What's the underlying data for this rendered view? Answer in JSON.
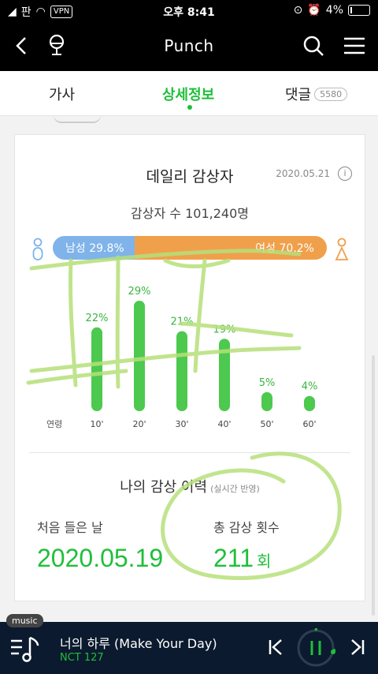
{
  "status": {
    "carrier": "판",
    "vpn": "VPN",
    "time": "오후 8:41",
    "battery": "4%"
  },
  "header": {
    "title": "Punch"
  },
  "tabs": [
    {
      "label": "가사"
    },
    {
      "label": "상세정보"
    },
    {
      "label": "댓글",
      "count": "5580"
    }
  ],
  "daily": {
    "title": "데일리 감상자",
    "date": "2020.05.21",
    "info_glyph": "i",
    "listeners": "감상자 수 101,240명",
    "male_label": "남성 29.8%",
    "female_label": "여성 70.2%",
    "male_share": 29.8,
    "female_share": 70.2
  },
  "chart_data": {
    "type": "bar",
    "xlabel": "연령",
    "categories": [
      "10'",
      "20'",
      "30'",
      "40'",
      "50'",
      "60'"
    ],
    "values": [
      22,
      29,
      21,
      19,
      5,
      4
    ],
    "value_labels": [
      "22%",
      "29%",
      "21%",
      "19%",
      "5%",
      "4%"
    ],
    "bar_color": "#4cc94e"
  },
  "history": {
    "title": "나의 감상 이력",
    "note": "(실시간 반영)",
    "first_label": "처음 들은 날",
    "first_value": "2020.05.19",
    "total_label": "총 감상 횟수",
    "total_value": "211",
    "total_unit": "회"
  },
  "player": {
    "tag": "music",
    "song": "너의 하루 (Make Your Day)",
    "artist": "NCT 127"
  },
  "colors": {
    "accent": "#1fbf3a",
    "male": "#7fb3ea",
    "female": "#f0a04b",
    "player_bg": "#0b1a2e"
  }
}
